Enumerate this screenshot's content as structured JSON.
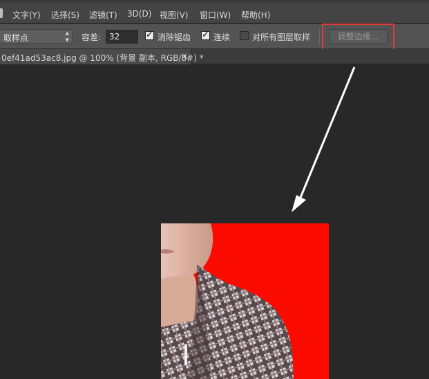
{
  "menubar": {
    "items": [
      "文字(Y)",
      "选择(S)",
      "滤镜(T)",
      "3D(D)",
      "视图(V)",
      "窗口(W)",
      "帮助(H)"
    ]
  },
  "options": {
    "sample_size": "取样点",
    "tolerance_label": "容差:",
    "tolerance_value": "32",
    "antialias_label": "消除锯齿",
    "contiguous_label": "连续",
    "sample_all_label": "对所有图层取样",
    "refine_edge_label": "调整边缘...",
    "antialias_checked": true,
    "contiguous_checked": true,
    "sample_all_checked": false
  },
  "document": {
    "tab_title": "0ef41ad53ac8.jpg @ 100% (背景 副本, RGB/8#) *",
    "close_glyph": "×"
  },
  "colors": {
    "highlight": "#e23b3b",
    "photo_background": "#fb0a00"
  },
  "icons": [
    "chevron-updown-icon",
    "checkbox-checked-icon",
    "checkbox-unchecked-icon",
    "close-icon",
    "arrow-pointer-icon"
  ]
}
